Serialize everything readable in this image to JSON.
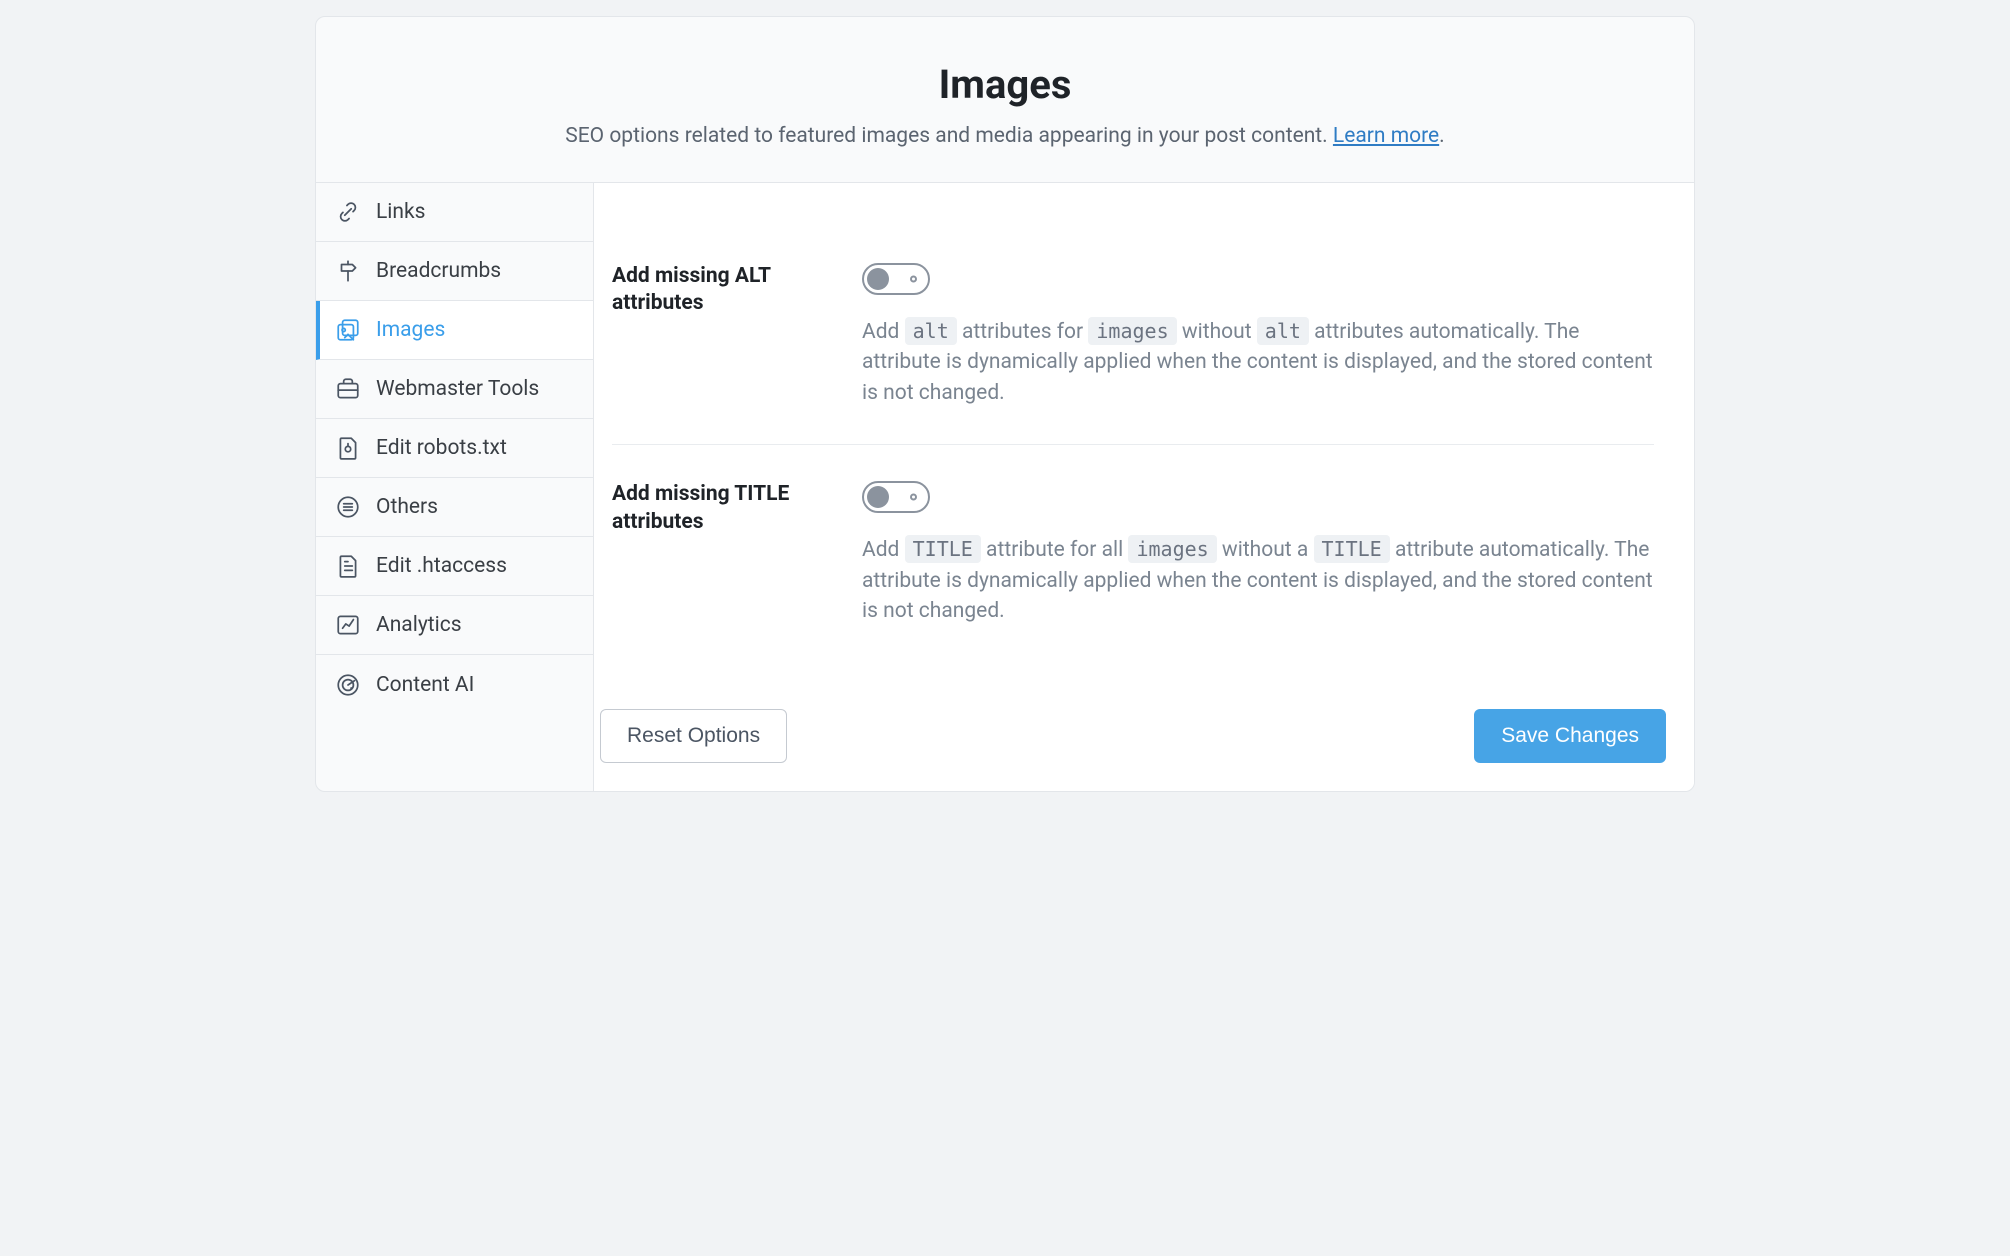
{
  "header": {
    "title": "Images",
    "subtitle_prefix": "SEO options related to featured images and media appearing in your post content. ",
    "learn_more": "Learn more",
    "subtitle_suffix": "."
  },
  "sidebar": {
    "items": [
      {
        "key": "links",
        "label": "Links",
        "icon": "link-icon",
        "active": false
      },
      {
        "key": "breadcrumbs",
        "label": "Breadcrumbs",
        "icon": "signpost-icon",
        "active": false
      },
      {
        "key": "images",
        "label": "Images",
        "icon": "images-icon",
        "active": true
      },
      {
        "key": "webmaster",
        "label": "Webmaster Tools",
        "icon": "briefcase-icon",
        "active": false
      },
      {
        "key": "robots",
        "label": "Edit robots.txt",
        "icon": "robots-file-icon",
        "active": false
      },
      {
        "key": "others",
        "label": "Others",
        "icon": "list-circle-icon",
        "active": false
      },
      {
        "key": "htaccess",
        "label": "Edit .htaccess",
        "icon": "file-lines-icon",
        "active": false
      },
      {
        "key": "analytics",
        "label": "Analytics",
        "icon": "chart-icon",
        "active": false
      },
      {
        "key": "contentai",
        "label": "Content AI",
        "icon": "radar-icon",
        "active": false
      }
    ]
  },
  "settings": {
    "alt": {
      "label": "Add missing ALT attributes",
      "enabled": false,
      "desc_parts": [
        "Add ",
        "alt",
        " attributes for ",
        "images",
        " without ",
        "alt",
        " attributes automatically. The attribute is dynamically applied when the content is displayed, and the stored content is not changed."
      ]
    },
    "title": {
      "label": "Add missing TITLE attributes",
      "enabled": false,
      "desc_parts": [
        "Add ",
        "TITLE",
        " attribute for all ",
        "images",
        " without a ",
        "TITLE",
        " attribute automatically. The attribute is dynamically applied when the content is displayed, and the stored content is not changed."
      ]
    }
  },
  "footer": {
    "reset": "Reset Options",
    "save": "Save Changes"
  }
}
